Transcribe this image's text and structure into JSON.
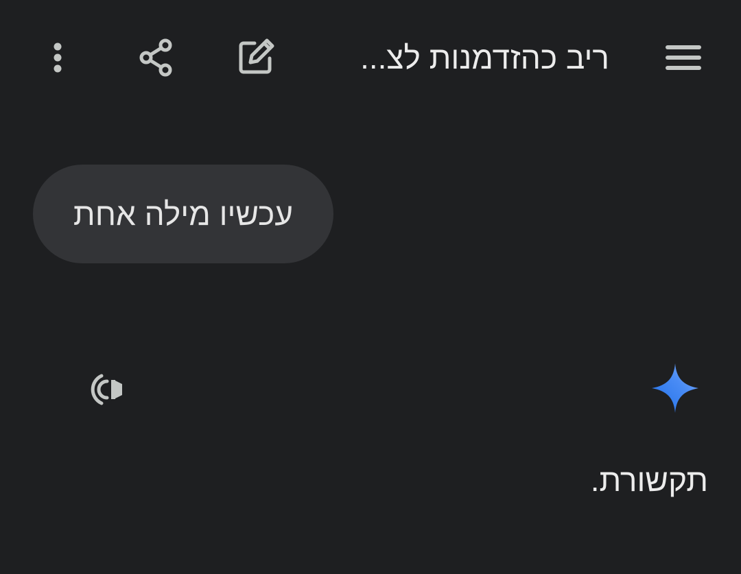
{
  "header": {
    "title": "ריב כהזדמנות לצ...",
    "menu_icon": "menu-icon",
    "edit_icon": "edit-icon",
    "share_icon": "share-icon",
    "more_icon": "more-vert-icon"
  },
  "conversation": {
    "user_message": "עכשיו מילה אחת",
    "assistant": {
      "icon": "gemini-spark-icon",
      "speaker_icon": "speaker-icon",
      "response": "תקשורת."
    }
  },
  "colors": {
    "background": "#1e1f21",
    "bubble": "#333437",
    "text": "#e3e3e3",
    "icon": "#c4c7c5",
    "accent_blue": "#4285f4"
  }
}
